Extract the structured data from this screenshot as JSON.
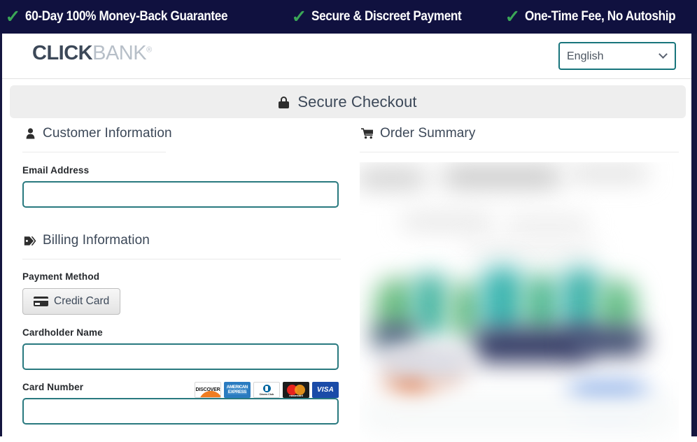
{
  "banner": {
    "items": [
      {
        "icon": "check-icon",
        "text": "60-Day 100% Money-Back Guarantee"
      },
      {
        "icon": "check-icon",
        "text": "Secure & Discreet Payment"
      },
      {
        "icon": "check-icon",
        "text": "One-Time Fee, No Autoship"
      }
    ],
    "background_color": "#10113f",
    "check_color": "#3ba757",
    "text_color": "#ffffff"
  },
  "header": {
    "logo": {
      "primary": "CLICK",
      "secondary": "BANK",
      "registered": "®"
    },
    "language": {
      "selected": "English",
      "options": [
        "English"
      ],
      "border_color": "#18757c"
    }
  },
  "secure_bar": {
    "icon": "lock-icon",
    "title": "Secure Checkout",
    "background_color": "#eeeeee"
  },
  "customer_section": {
    "icon": "person-icon",
    "title": "Customer Information",
    "email": {
      "label": "Email Address",
      "value": "",
      "placeholder": ""
    }
  },
  "billing_section": {
    "icon": "tag-icon",
    "title": "Billing Information",
    "payment_method": {
      "label": "Payment Method",
      "selected_button": "Credit Card",
      "button_icon": "credit-card-icon"
    },
    "cardholder_name": {
      "label": "Cardholder Name",
      "value": "",
      "placeholder": ""
    },
    "card_number": {
      "label": "Card Number",
      "value": "",
      "placeholder": ""
    },
    "accepted_cards": [
      {
        "name": "discover-logo",
        "label": "DISCOVER"
      },
      {
        "name": "amex-logo",
        "label_line1": "AMERICAN",
        "label_line2": "EXPRESS"
      },
      {
        "name": "diners-club-logo",
        "label": "Diners Club",
        "sub": "INTERNATIONAL"
      },
      {
        "name": "mastercard-logo",
        "label": "mastercard"
      },
      {
        "name": "visa-logo",
        "label": "VISA"
      }
    ]
  },
  "order_section": {
    "icon": "cart-icon",
    "title": "Order Summary",
    "content_state": "blurred"
  },
  "theme": {
    "input_border": "#29797f",
    "heading_text": "#3c4858",
    "label_text": "#26292d",
    "rule_color": "#eaeaea",
    "frame_border": "#15163f"
  }
}
